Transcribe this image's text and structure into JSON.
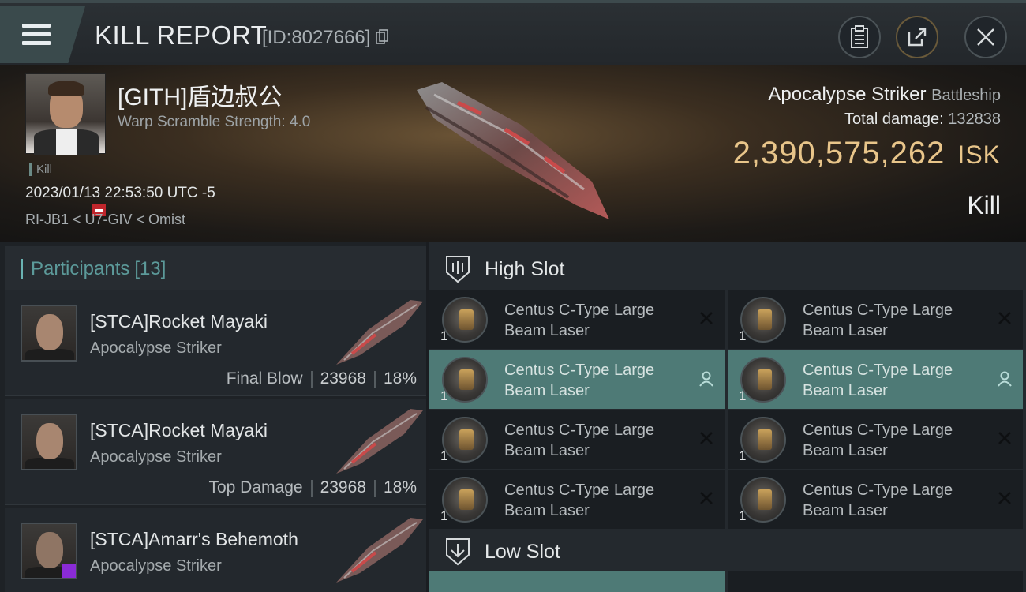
{
  "header": {
    "title": "KILL REPORT",
    "report_id": "[ID:8027666]",
    "icons": [
      "menu-icon",
      "copy-icon",
      "clipboard-icon",
      "share-icon",
      "close-icon"
    ]
  },
  "victim": {
    "name": "[GITH]盾边叔公",
    "warp_scramble": "Warp Scramble Strength: 4.0",
    "kill_tag": "Kill",
    "date": "2023/01/13 22:53:50 UTC -5",
    "location": "RI-JB1 < U7-GIV < Omist",
    "ship_name": "Apocalypse Striker",
    "ship_class": "Battleship",
    "total_damage_label": "Total damage:",
    "total_damage": "132838",
    "isk_value": "2,390,575,262",
    "isk_unit": "ISK",
    "result": "Kill"
  },
  "participants": {
    "label": "Participants",
    "count": "[13]",
    "rows": [
      {
        "name": "[STCA]Rocket Mayaki",
        "ship": "Apocalypse Striker",
        "tag": "Final Blow",
        "damage": "23968",
        "percent": "18%"
      },
      {
        "name": "[STCA]Rocket Mayaki",
        "ship": "Apocalypse Striker",
        "tag": "Top Damage",
        "damage": "23968",
        "percent": "18%"
      },
      {
        "name": "[STCA]Amarr's Behemoth",
        "ship": "Apocalypse Striker",
        "tag": "",
        "damage": "",
        "percent": ""
      }
    ]
  },
  "slots": {
    "high": {
      "label": "High Slot",
      "items": [
        {
          "line1": "Centus C-Type Large",
          "line2": "Beam Laser",
          "qty": "1",
          "state": "destroyed"
        },
        {
          "line1": "Centus C-Type Large",
          "line2": "Beam Laser",
          "qty": "1",
          "state": "destroyed"
        },
        {
          "line1": "Centus C-Type Large",
          "line2": "Beam Laser",
          "qty": "1",
          "state": "dropped"
        },
        {
          "line1": "Centus C-Type Large",
          "line2": "Beam Laser",
          "qty": "1",
          "state": "dropped"
        },
        {
          "line1": "Centus C-Type Large",
          "line2": "Beam Laser",
          "qty": "1",
          "state": "destroyed"
        },
        {
          "line1": "Centus C-Type Large",
          "line2": "Beam Laser",
          "qty": "1",
          "state": "destroyed"
        },
        {
          "line1": "Centus C-Type Large",
          "line2": "Beam Laser",
          "qty": "1",
          "state": "destroyed"
        },
        {
          "line1": "Centus C-Type Large",
          "line2": "Beam Laser",
          "qty": "1",
          "state": "destroyed"
        }
      ]
    },
    "low": {
      "label": "Low Slot"
    }
  },
  "colors": {
    "isk_gold": "#e8c58a",
    "teal_accent": "#5c9a9a",
    "active_item": "#4e7a76",
    "purple_badge": "#8a2bd6",
    "red_badge": "#c0262c"
  }
}
